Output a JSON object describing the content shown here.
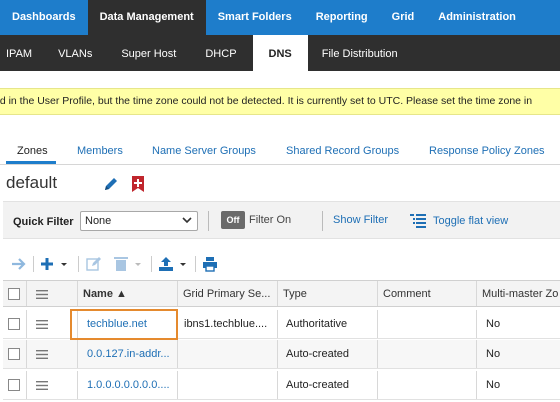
{
  "top_nav": [
    "Dashboards",
    "Data Management",
    "Smart Folders",
    "Reporting",
    "Grid",
    "Administration"
  ],
  "top_nav_active": "Data Management",
  "sub_nav": [
    "IPAM",
    "VLANs",
    "Super Host",
    "DHCP",
    "DNS",
    "File Distribution"
  ],
  "sub_nav_active": "DNS",
  "banner_text": "ed in the User Profile, but the time zone could not be detected. It is currently set to UTC. Please set the time zone in",
  "zone_tabs": [
    "Zones",
    "Members",
    "Name Server Groups",
    "Shared Record Groups",
    "Response Policy Zones"
  ],
  "view_title": "default",
  "filter": {
    "label": "Quick Filter",
    "value": "None",
    "toggle": "Off",
    "filter_on": "Filter On",
    "show_filter": "Show Filter",
    "toggle_flat": "Toggle flat view"
  },
  "table": {
    "headers": [
      "Name ▲",
      "Grid Primary Se...",
      "Type",
      "Comment",
      "Multi-master Zo"
    ],
    "rows": [
      {
        "name": "techblue.net",
        "primary": "ibns1.techblue....",
        "type": "Authoritative",
        "comment": "",
        "multi": "No"
      },
      {
        "name": "0.0.127.in-addr...",
        "primary": "",
        "type": "Auto-created",
        "comment": "",
        "multi": "No"
      },
      {
        "name": "1.0.0.0.0.0.0.0....",
        "primary": "",
        "type": "Auto-created",
        "comment": "",
        "multi": "No"
      }
    ]
  },
  "icons": {
    "edit": "pencil-icon",
    "bookmark": "bookmark-plus-icon",
    "flat_view": "list-tree-icon",
    "go": "arrow-right-icon",
    "add": "plus-icon",
    "edit_tb": "edit-icon",
    "delete": "trash-icon",
    "export": "export-icon",
    "print": "printer-icon"
  },
  "colors": {
    "nav_blue": "#1e7dcb",
    "dark": "#2f2f2f",
    "link": "#1e6fb5",
    "banner": "#ffffa6",
    "highlight": "#e58a2e",
    "bookmark_red": "#c0262d"
  }
}
